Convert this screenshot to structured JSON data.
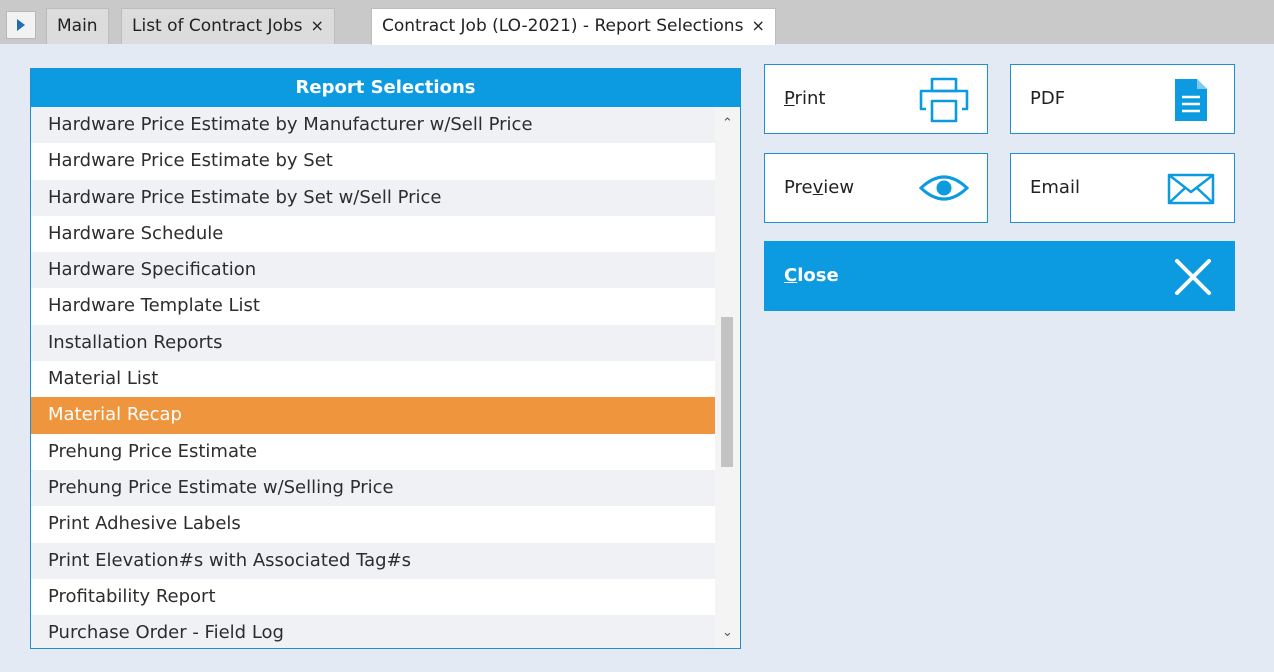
{
  "tabs": [
    {
      "label": "Main",
      "closable": false
    },
    {
      "label": "List of Contract Jobs",
      "closable": true
    },
    {
      "label": "Contract Job (LO-2021) - Report Selections",
      "closable": true,
      "active": true
    }
  ],
  "tab_close_glyph": "×",
  "report_panel": {
    "title": "Report Selections",
    "items": [
      "Hardware Price Estimate by Manufacturer w/Sell Price",
      "Hardware Price Estimate by Set",
      "Hardware Price Estimate by Set w/Sell Price",
      "Hardware Schedule",
      "Hardware Specification",
      "Hardware Template List",
      "Installation Reports",
      "Material List",
      "Material Recap",
      "Prehung Price Estimate",
      "Prehung Price Estimate w/Selling Price",
      "Print Adhesive Labels",
      "Print Elevation#s with Associated Tag#s",
      "Profitability Report",
      "Purchase Order - Field Log"
    ],
    "selected_item": "Material Recap"
  },
  "actions": {
    "print": {
      "pre": "",
      "ul": "P",
      "post": "rint",
      "icon": "printer-icon"
    },
    "pdf": {
      "label": "PDF",
      "icon": "document-icon"
    },
    "preview": {
      "pre": "Pre",
      "ul": "v",
      "post": "iew",
      "icon": "eye-icon"
    },
    "email": {
      "label": "Email",
      "icon": "envelope-icon"
    },
    "close": {
      "pre": "",
      "ul": "C",
      "post": "lose",
      "icon": "close-x-icon"
    }
  },
  "colors": {
    "accent": "#0c9be0",
    "selected_row": "#ef953d",
    "background": "#e4eaf3"
  }
}
